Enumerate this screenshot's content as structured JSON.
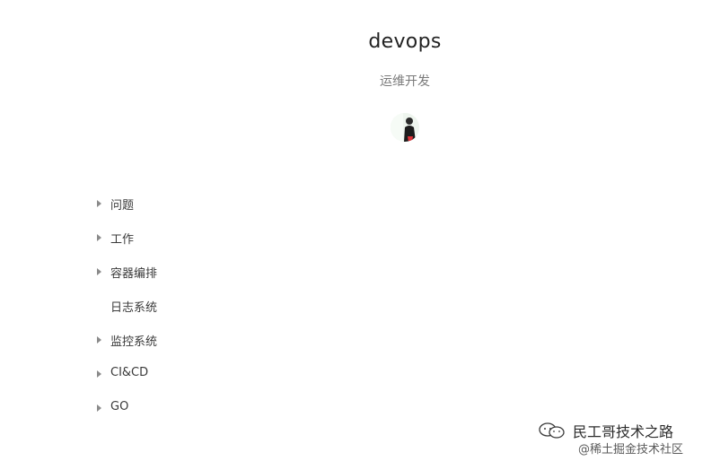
{
  "header": {
    "title": "devops",
    "subtitle": "运维开发"
  },
  "nav": {
    "items": [
      {
        "label": "问题",
        "expandable": true
      },
      {
        "label": "工作",
        "expandable": true
      },
      {
        "label": "容器编排",
        "expandable": true
      },
      {
        "label": "日志系统",
        "expandable": false
      },
      {
        "label": "监控系统",
        "expandable": true
      },
      {
        "label": "CI&CD",
        "expandable": true
      },
      {
        "label": "GO",
        "expandable": true
      }
    ]
  },
  "watermark": {
    "line1": "民工哥技术之路",
    "line2": "@稀土掘金技术社区",
    "icon": "wechat-icon"
  },
  "colors": {
    "text": "#333333",
    "muted": "#7a7a7a",
    "caret": "#8a8a8a",
    "avatar_accent": "#e0343a"
  }
}
